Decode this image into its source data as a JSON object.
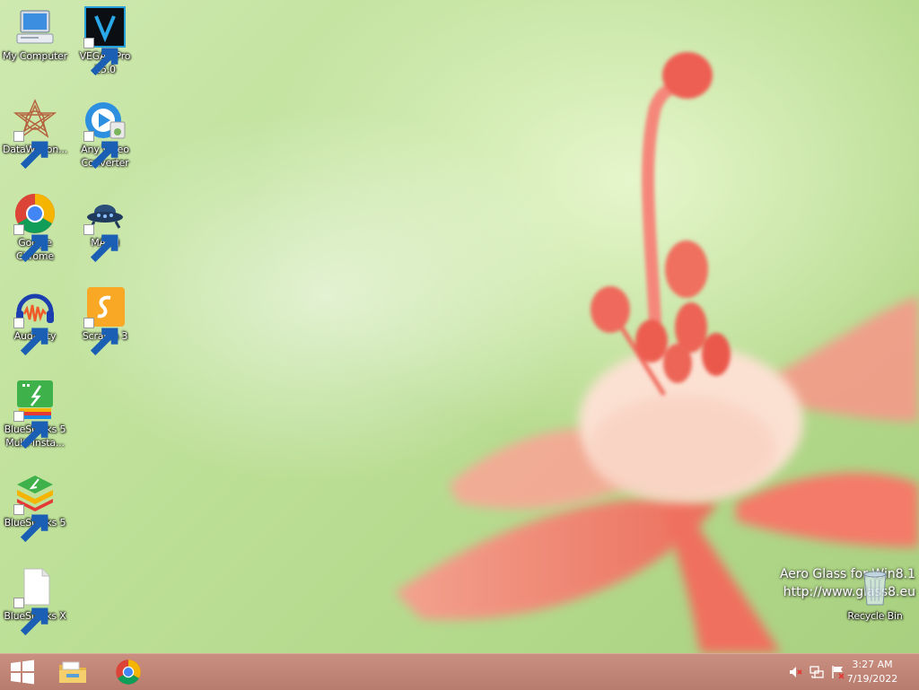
{
  "desktop_icons": [
    {
      "label": "My Computer",
      "icon": "computer-icon"
    },
    {
      "label": "VEGAS Pro 15.0",
      "icon": "vegas-pro-icon"
    },
    {
      "label": "DataWagon...",
      "icon": "datawagon-icon"
    },
    {
      "label": "Any Video Converter",
      "icon": "any-video-converter-icon"
    },
    {
      "label": "Google Chrome",
      "icon": "chrome-icon"
    },
    {
      "label": "MASH",
      "icon": "mash-icon"
    },
    {
      "label": "Audacity",
      "icon": "audacity-icon"
    },
    {
      "label": "Scratch 3",
      "icon": "scratch-icon"
    },
    {
      "label": "BlueStacks 5 Multi-Insta...",
      "icon": "bluestacks-multi-icon"
    },
    {
      "label": "BlueStacks 5",
      "icon": "bluestacks-icon"
    },
    {
      "label": "BlueStacks X",
      "icon": "file-icon"
    },
    {
      "label": "Recycle Bin",
      "icon": "recycle-bin-icon"
    }
  ],
  "watermark": {
    "line1": "Aero Glass for Win8.1",
    "line2": "http://www.glass8.eu"
  },
  "taskbar": {
    "pinned": [
      {
        "name": "start-button",
        "icon": "windows-logo-icon"
      },
      {
        "name": "file-explorer",
        "icon": "folder-icon"
      },
      {
        "name": "google-chrome",
        "icon": "chrome-icon"
      }
    ],
    "tray_icons": [
      "speaker-muted-icon",
      "network-icon",
      "action-center-flag-icon"
    ],
    "time": "3:27 AM",
    "date": "7/19/2022"
  },
  "colors": {
    "taskbar": "#b87c6e",
    "wallpaper_green": "#bfe19a",
    "flower": "#f07a6a"
  }
}
